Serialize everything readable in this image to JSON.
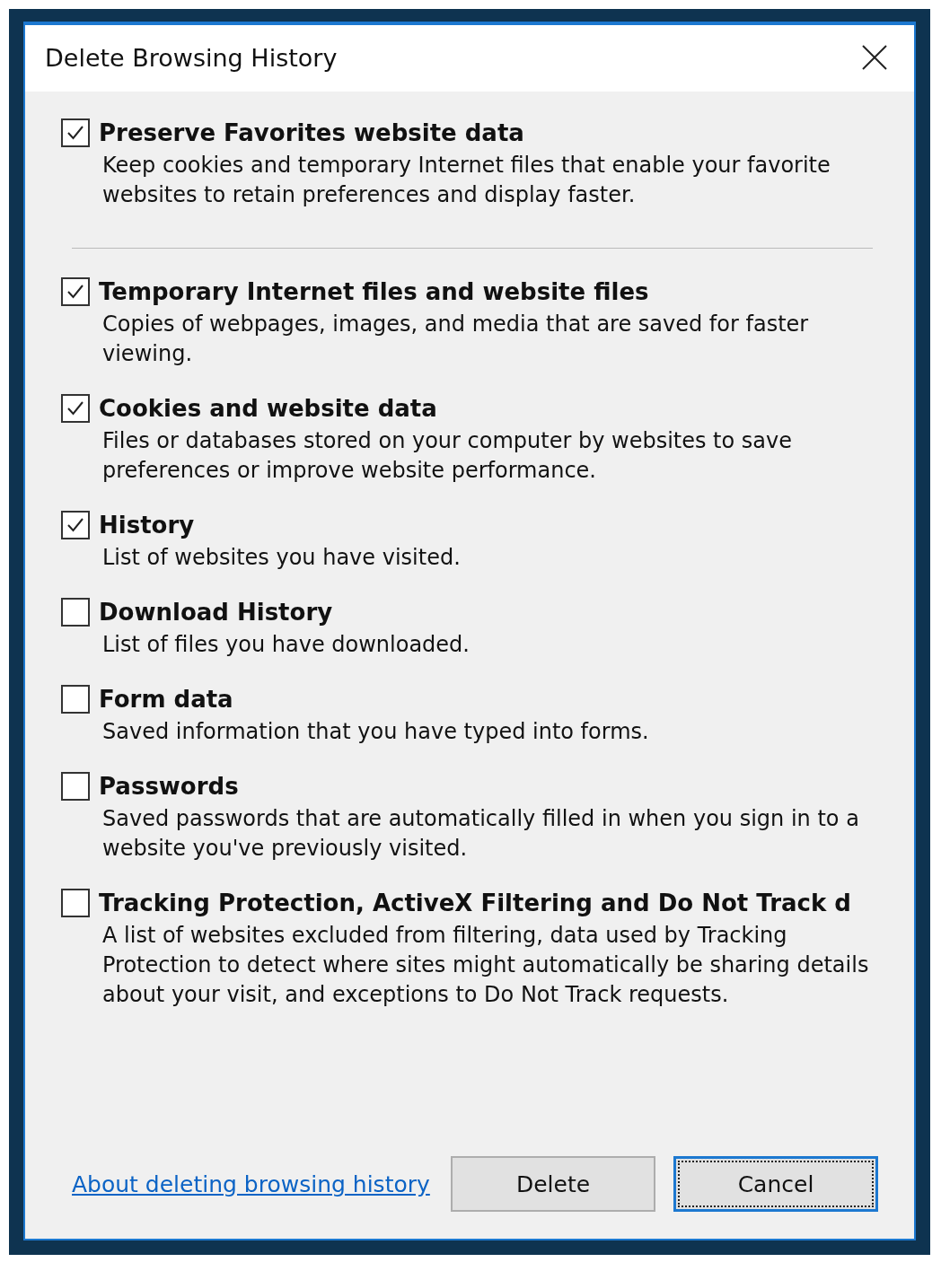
{
  "window": {
    "title": "Delete Browsing History"
  },
  "options": [
    {
      "label": "Preserve Favorites website data",
      "description": "Keep cookies and temporary Internet files that enable your favorite websites to retain preferences and display faster.",
      "checked": true,
      "separator_after": true
    },
    {
      "label": "Temporary Internet files and website files",
      "description": "Copies of webpages, images, and media that are saved for faster viewing.",
      "checked": true
    },
    {
      "label": "Cookies and website data",
      "description": "Files or databases stored on your computer by websites to save preferences or improve website performance.",
      "checked": true
    },
    {
      "label": "History",
      "description": "List of websites you have visited.",
      "checked": true
    },
    {
      "label": "Download History",
      "description": "List of files you have downloaded.",
      "checked": false
    },
    {
      "label": "Form data",
      "description": "Saved information that you have typed into forms.",
      "checked": false
    },
    {
      "label": "Passwords",
      "description": "Saved passwords that are automatically filled in when you sign in to a website you've previously visited.",
      "checked": false
    },
    {
      "label": "Tracking Protection, ActiveX Filtering and Do Not Track d",
      "description": "A list of websites excluded from filtering, data used by Tracking Protection to detect where sites might automatically be sharing details about your visit, and exceptions to Do Not Track requests.",
      "checked": false
    }
  ],
  "link": "About deleting browsing history",
  "buttons": [
    {
      "label": "Delete",
      "focused": false
    },
    {
      "label": "Cancel",
      "focused": true
    }
  ]
}
